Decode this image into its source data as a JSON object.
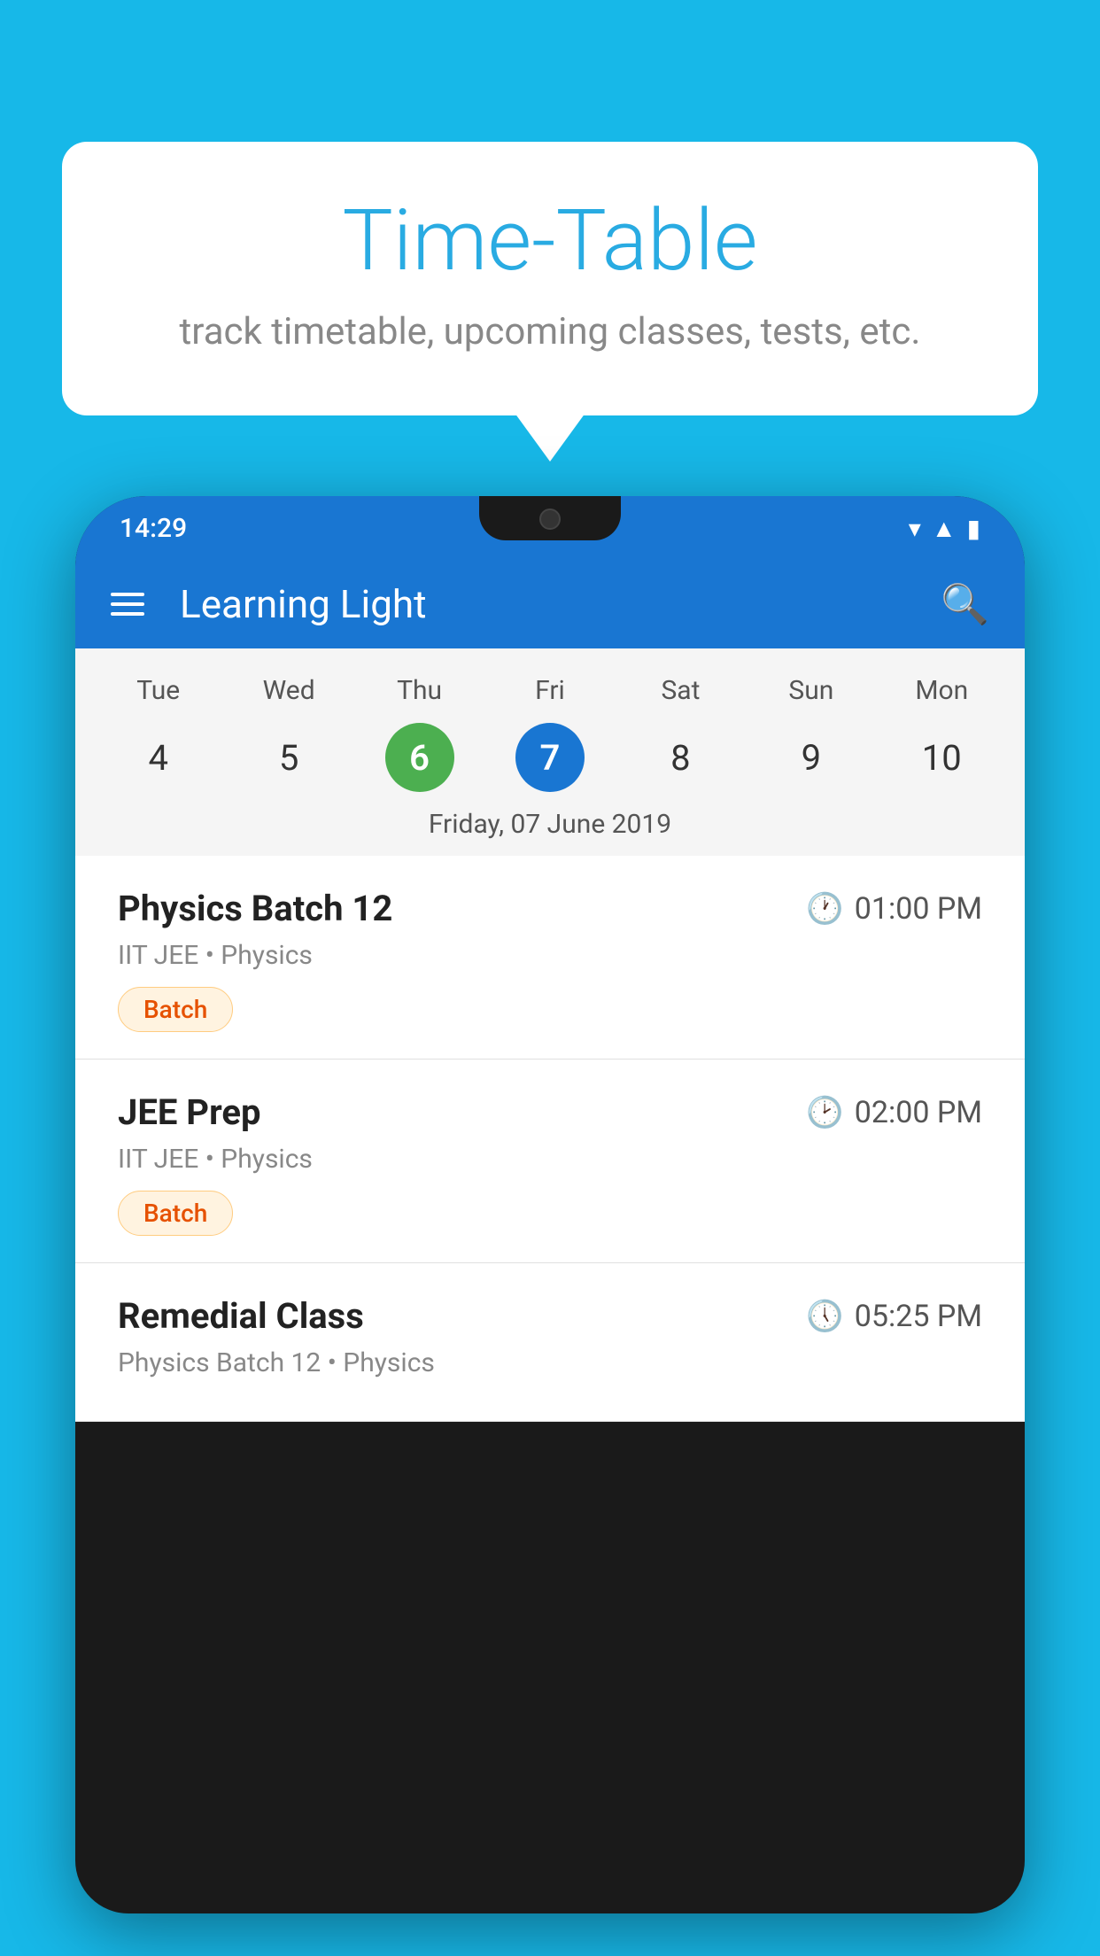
{
  "background_color": "#17b8e8",
  "speech_bubble": {
    "title": "Time-Table",
    "subtitle": "track timetable, upcoming classes, tests, etc."
  },
  "phone": {
    "status_bar": {
      "time": "14:29"
    },
    "toolbar": {
      "title": "Learning Light"
    },
    "calendar": {
      "days": [
        {
          "name": "Tue",
          "num": "4",
          "state": "normal"
        },
        {
          "name": "Wed",
          "num": "5",
          "state": "normal"
        },
        {
          "name": "Thu",
          "num": "6",
          "state": "today"
        },
        {
          "name": "Fri",
          "num": "7",
          "state": "selected"
        },
        {
          "name": "Sat",
          "num": "8",
          "state": "normal"
        },
        {
          "name": "Sun",
          "num": "9",
          "state": "normal"
        },
        {
          "name": "Mon",
          "num": "10",
          "state": "normal"
        }
      ],
      "selected_date_label": "Friday, 07 June 2019"
    },
    "classes": [
      {
        "name": "Physics Batch 12",
        "time": "01:00 PM",
        "meta": "IIT JEE • Physics",
        "badge": "Batch"
      },
      {
        "name": "JEE Prep",
        "time": "02:00 PM",
        "meta": "IIT JEE • Physics",
        "badge": "Batch"
      },
      {
        "name": "Remedial Class",
        "time": "05:25 PM",
        "meta": "Physics Batch 12 • Physics",
        "badge": null
      }
    ]
  }
}
